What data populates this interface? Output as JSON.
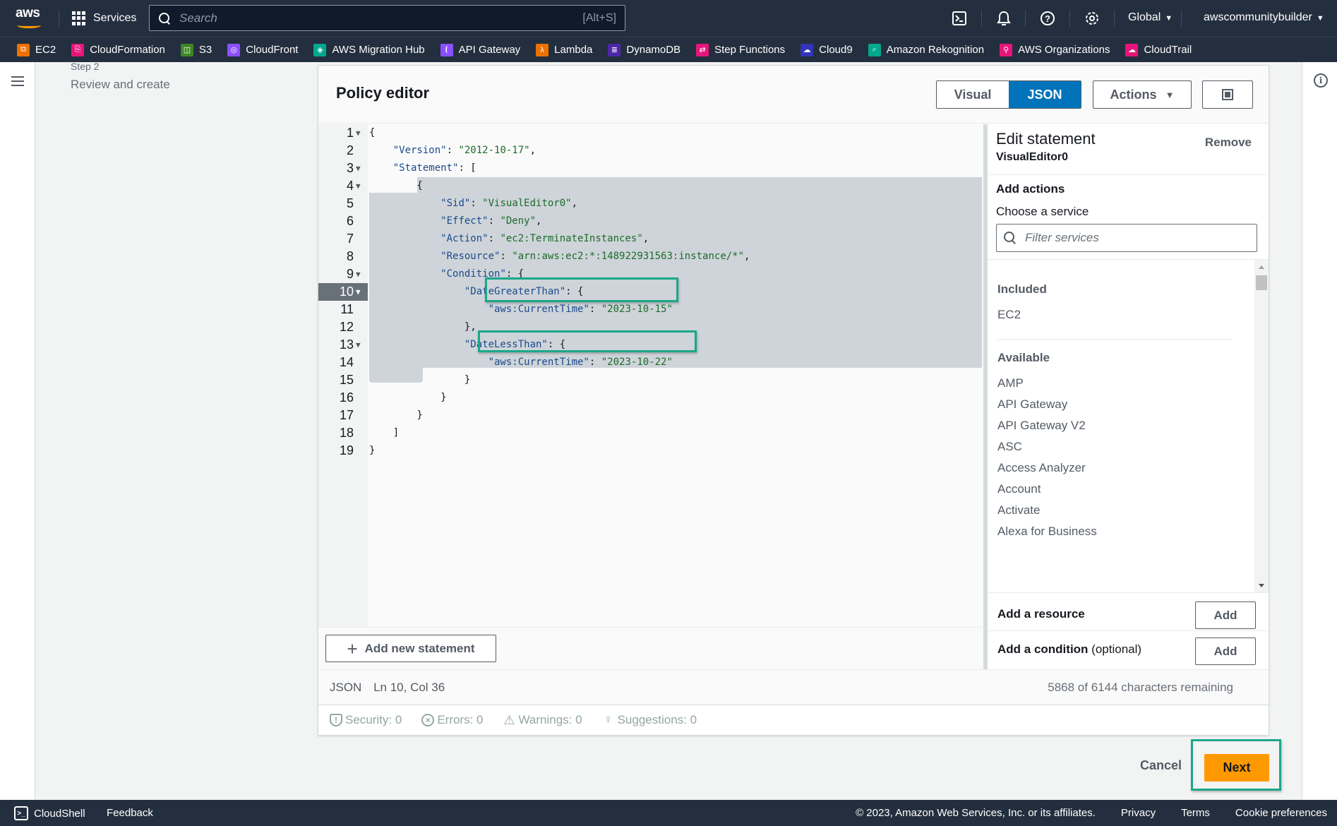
{
  "topnav": {
    "logo": "aws",
    "services_label": "Services",
    "search_placeholder": "Search",
    "search_shortcut": "[Alt+S]",
    "region": "Global",
    "account": "awscommunitybuilder",
    "icons": [
      "cloudshell-icon",
      "notifications-icon",
      "help-icon",
      "settings-icon"
    ]
  },
  "favorites": [
    {
      "label": "EC2",
      "color": "#ed7100",
      "glyph": "⧉"
    },
    {
      "label": "CloudFormation",
      "color": "#e7157b",
      "glyph": "⎘"
    },
    {
      "label": "S3",
      "color": "#3f8624",
      "glyph": "◫"
    },
    {
      "label": "CloudFront",
      "color": "#8c4fff",
      "glyph": "◎"
    },
    {
      "label": "AWS Migration Hub",
      "color": "#01a88d",
      "glyph": "◈"
    },
    {
      "label": "API Gateway",
      "color": "#8c4fff",
      "glyph": "⦗"
    },
    {
      "label": "Lambda",
      "color": "#ed7100",
      "glyph": "λ"
    },
    {
      "label": "DynamoDB",
      "color": "#4d27aa",
      "glyph": "≣"
    },
    {
      "label": "Step Functions",
      "color": "#e7157b",
      "glyph": "⇄"
    },
    {
      "label": "Cloud9",
      "color": "#3334b9",
      "glyph": "☁"
    },
    {
      "label": "Amazon Rekognition",
      "color": "#01a88d",
      "glyph": "⌕"
    },
    {
      "label": "AWS Organizations",
      "color": "#e7157b",
      "glyph": "⚲"
    },
    {
      "label": "CloudTrail",
      "color": "#e7157b",
      "glyph": "☁"
    }
  ],
  "steps": {
    "step_label": "Step 2",
    "step_title": "Review and create"
  },
  "editor": {
    "title": "Policy editor",
    "mode_visual": "Visual",
    "mode_json": "JSON",
    "active_mode": "JSON",
    "actions_label": "Actions",
    "code_lines": [
      {
        "n": "1",
        "fold": true,
        "html": "{"
      },
      {
        "n": "2",
        "fold": false,
        "html": "    <span class='k'>\"Version\"</span>: <span class='s'>\"2012-10-17\"</span>,"
      },
      {
        "n": "3",
        "fold": true,
        "html": "    <span class='k'>\"Statement\"</span>: ["
      },
      {
        "n": "4",
        "fold": true,
        "html": "        {"
      },
      {
        "n": "5",
        "fold": false,
        "html": "            <span class='k'>\"Sid\"</span>: <span class='s'>\"VisualEditor0\"</span>,"
      },
      {
        "n": "6",
        "fold": false,
        "html": "            <span class='k'>\"Effect\"</span>: <span class='s'>\"Deny\"</span>,"
      },
      {
        "n": "7",
        "fold": false,
        "html": "            <span class='k'>\"Action\"</span>: <span class='s'>\"ec2:TerminateInstances\"</span>,"
      },
      {
        "n": "8",
        "fold": false,
        "html": "            <span class='k'>\"Resource\"</span>: <span class='s'>\"arn:aws:ec2:*:148922931563:instance/*\"</span>,"
      },
      {
        "n": "9",
        "fold": true,
        "html": "            <span class='k'>\"Condition\"</span>: {"
      },
      {
        "n": "10",
        "fold": true,
        "html": "                <span class='k'>\"DateGreaterThan\"</span>: {"
      },
      {
        "n": "11",
        "fold": false,
        "html": "                    <span class='k'>\"aws:CurrentTime\"</span>: <span class='s'>\"2023-10-15\"</span>"
      },
      {
        "n": "12",
        "fold": false,
        "html": "                },"
      },
      {
        "n": "13",
        "fold": true,
        "html": "                <span class='k'>\"DateLessThan\"</span>: {"
      },
      {
        "n": "14",
        "fold": false,
        "html": "                    <span class='k'>\"aws:CurrentTime\"</span>: <span class='s'>\"2023-10-22\"</span>"
      },
      {
        "n": "15",
        "fold": false,
        "html": "                }"
      },
      {
        "n": "16",
        "fold": false,
        "html": "            }"
      },
      {
        "n": "17",
        "fold": false,
        "html": "        }"
      },
      {
        "n": "18",
        "fold": false,
        "html": "    ]"
      },
      {
        "n": "19",
        "fold": false,
        "html": "}"
      }
    ],
    "active_line": "10",
    "add_statement_label": "Add new statement",
    "status_mode": "JSON",
    "cursor_position": "Ln 10, Col 36",
    "characters_remaining": "5868 of 6144 characters remaining",
    "validation": {
      "security": "Security: 0",
      "errors": "Errors: 0",
      "warnings": "Warnings: 0",
      "suggestions": "Suggestions: 0"
    }
  },
  "side_panel": {
    "title": "Edit statement",
    "statement_id": "VisualEditor0",
    "remove_label": "Remove",
    "add_actions_label": "Add actions",
    "choose_service_label": "Choose a service",
    "filter_placeholder": "Filter services",
    "included_heading": "Included",
    "included": [
      "EC2"
    ],
    "available_heading": "Available",
    "available": [
      "AMP",
      "API Gateway",
      "API Gateway V2",
      "ASC",
      "Access Analyzer",
      "Account",
      "Activate",
      "Alexa for Business"
    ],
    "add_resource_label": "Add a resource",
    "add_condition_label": "Add a condition",
    "optional_label": "(optional)",
    "add_button": "Add"
  },
  "footer_actions": {
    "cancel": "Cancel",
    "next": "Next"
  },
  "bottombar": {
    "cloudshell": "CloudShell",
    "feedback": "Feedback",
    "copyright": "© 2023, Amazon Web Services, Inc. or its affiliates.",
    "privacy": "Privacy",
    "terms": "Terms",
    "cookie": "Cookie preferences"
  },
  "colors": {
    "nav_bg": "#232f3e",
    "primary_blue": "#0073bb",
    "next_orange": "#ff9900",
    "highlight_green": "#1aa88a"
  }
}
